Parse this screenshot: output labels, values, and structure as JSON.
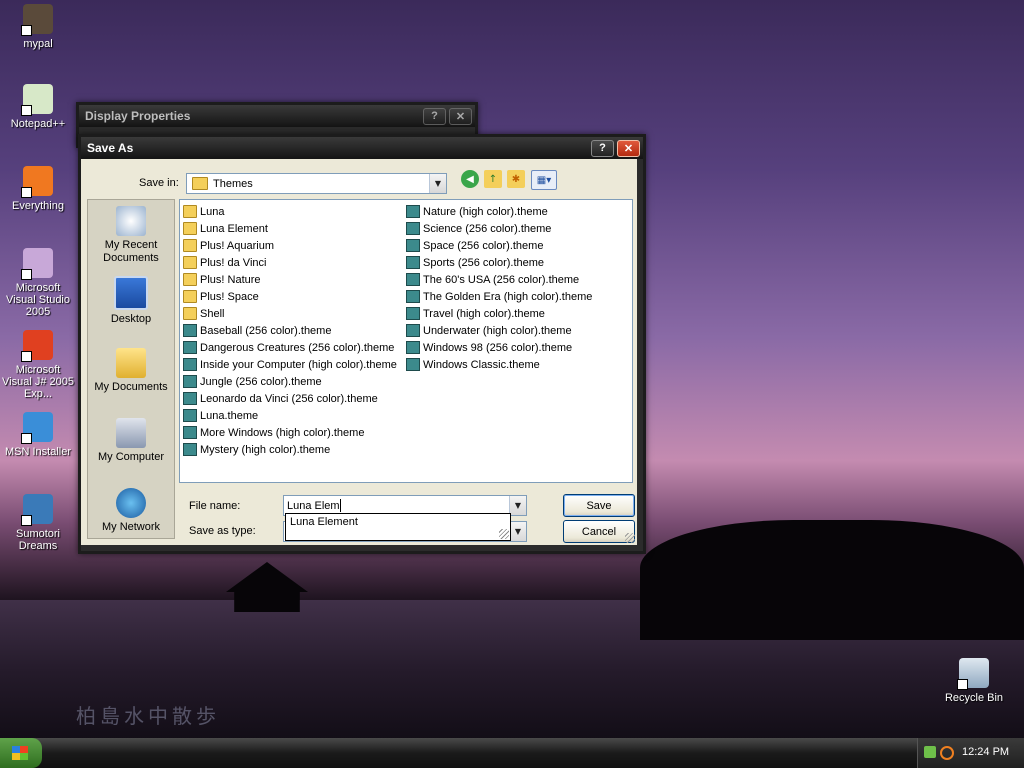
{
  "desktop": {
    "icons": [
      {
        "label": "mypal",
        "color": "#5a4a3a"
      },
      {
        "label": "Notepad++",
        "color": "#d7e8c8"
      },
      {
        "label": "Everything",
        "color": "#f07820"
      },
      {
        "label": "Microsoft Visual Studio 2005",
        "color": "#c8a8d8"
      },
      {
        "label": "Microsoft Visual J# 2005 Exp...",
        "color": "#e04020"
      },
      {
        "label": "MSN Installer",
        "color": "#3a8ed8"
      },
      {
        "label": "Sumotori Dreams",
        "color": "#3a7ab8"
      }
    ],
    "recycle_bin": "Recycle Bin",
    "watermark": "柏島水中散歩"
  },
  "display_properties": {
    "title": "Display Properties",
    "help": "?",
    "close": "✕"
  },
  "save_as": {
    "title": "Save As",
    "help": "?",
    "close": "✕",
    "save_in_label": "Save in:",
    "save_in_value": "Themes",
    "places": [
      {
        "label": "My Recent Documents",
        "icon": "recent-documents-icon"
      },
      {
        "label": "Desktop",
        "icon": "desktop-icon"
      },
      {
        "label": "My Documents",
        "icon": "my-documents-icon"
      },
      {
        "label": "My Computer",
        "icon": "my-computer-icon"
      },
      {
        "label": "My Network",
        "icon": "my-network-icon"
      }
    ],
    "files_col1": [
      {
        "name": "Luna",
        "type": "folder"
      },
      {
        "name": "Luna Element",
        "type": "folder"
      },
      {
        "name": "Plus! Aquarium",
        "type": "folder"
      },
      {
        "name": "Plus! da Vinci",
        "type": "folder"
      },
      {
        "name": "Plus! Nature",
        "type": "folder"
      },
      {
        "name": "Plus! Space",
        "type": "folder"
      },
      {
        "name": "Shell",
        "type": "folder"
      },
      {
        "name": "Baseball (256 color).theme",
        "type": "theme"
      },
      {
        "name": "Dangerous Creatures (256 color).theme",
        "type": "theme"
      },
      {
        "name": "Inside your Computer (high color).theme",
        "type": "theme"
      },
      {
        "name": "Jungle (256 color).theme",
        "type": "theme"
      },
      {
        "name": "Leonardo da Vinci (256 color).theme",
        "type": "theme"
      },
      {
        "name": "Luna.theme",
        "type": "theme"
      },
      {
        "name": "More Windows (high color).theme",
        "type": "theme"
      },
      {
        "name": "Mystery (high color).theme",
        "type": "theme"
      }
    ],
    "files_col2": [
      {
        "name": "Nature (high color).theme",
        "type": "theme"
      },
      {
        "name": "Science (256 color).theme",
        "type": "theme"
      },
      {
        "name": "Space (256 color).theme",
        "type": "theme"
      },
      {
        "name": "Sports (256 color).theme",
        "type": "theme"
      },
      {
        "name": "The 60's USA (256 color).theme",
        "type": "theme"
      },
      {
        "name": "The Golden Era (high color).theme",
        "type": "theme"
      },
      {
        "name": "Travel (high color).theme",
        "type": "theme"
      },
      {
        "name": "Underwater (high color).theme",
        "type": "theme"
      },
      {
        "name": "Windows 98 (256 color).theme",
        "type": "theme"
      },
      {
        "name": "Windows Classic.theme",
        "type": "theme"
      }
    ],
    "file_name_label": "File name:",
    "file_name_value": "Luna Elem",
    "save_as_type_label": "Save as type:",
    "autocomplete_item": "Luna Element",
    "save_button": "Save",
    "cancel_button": "Cancel"
  },
  "taskbar": {
    "clock": "12:24 PM"
  }
}
